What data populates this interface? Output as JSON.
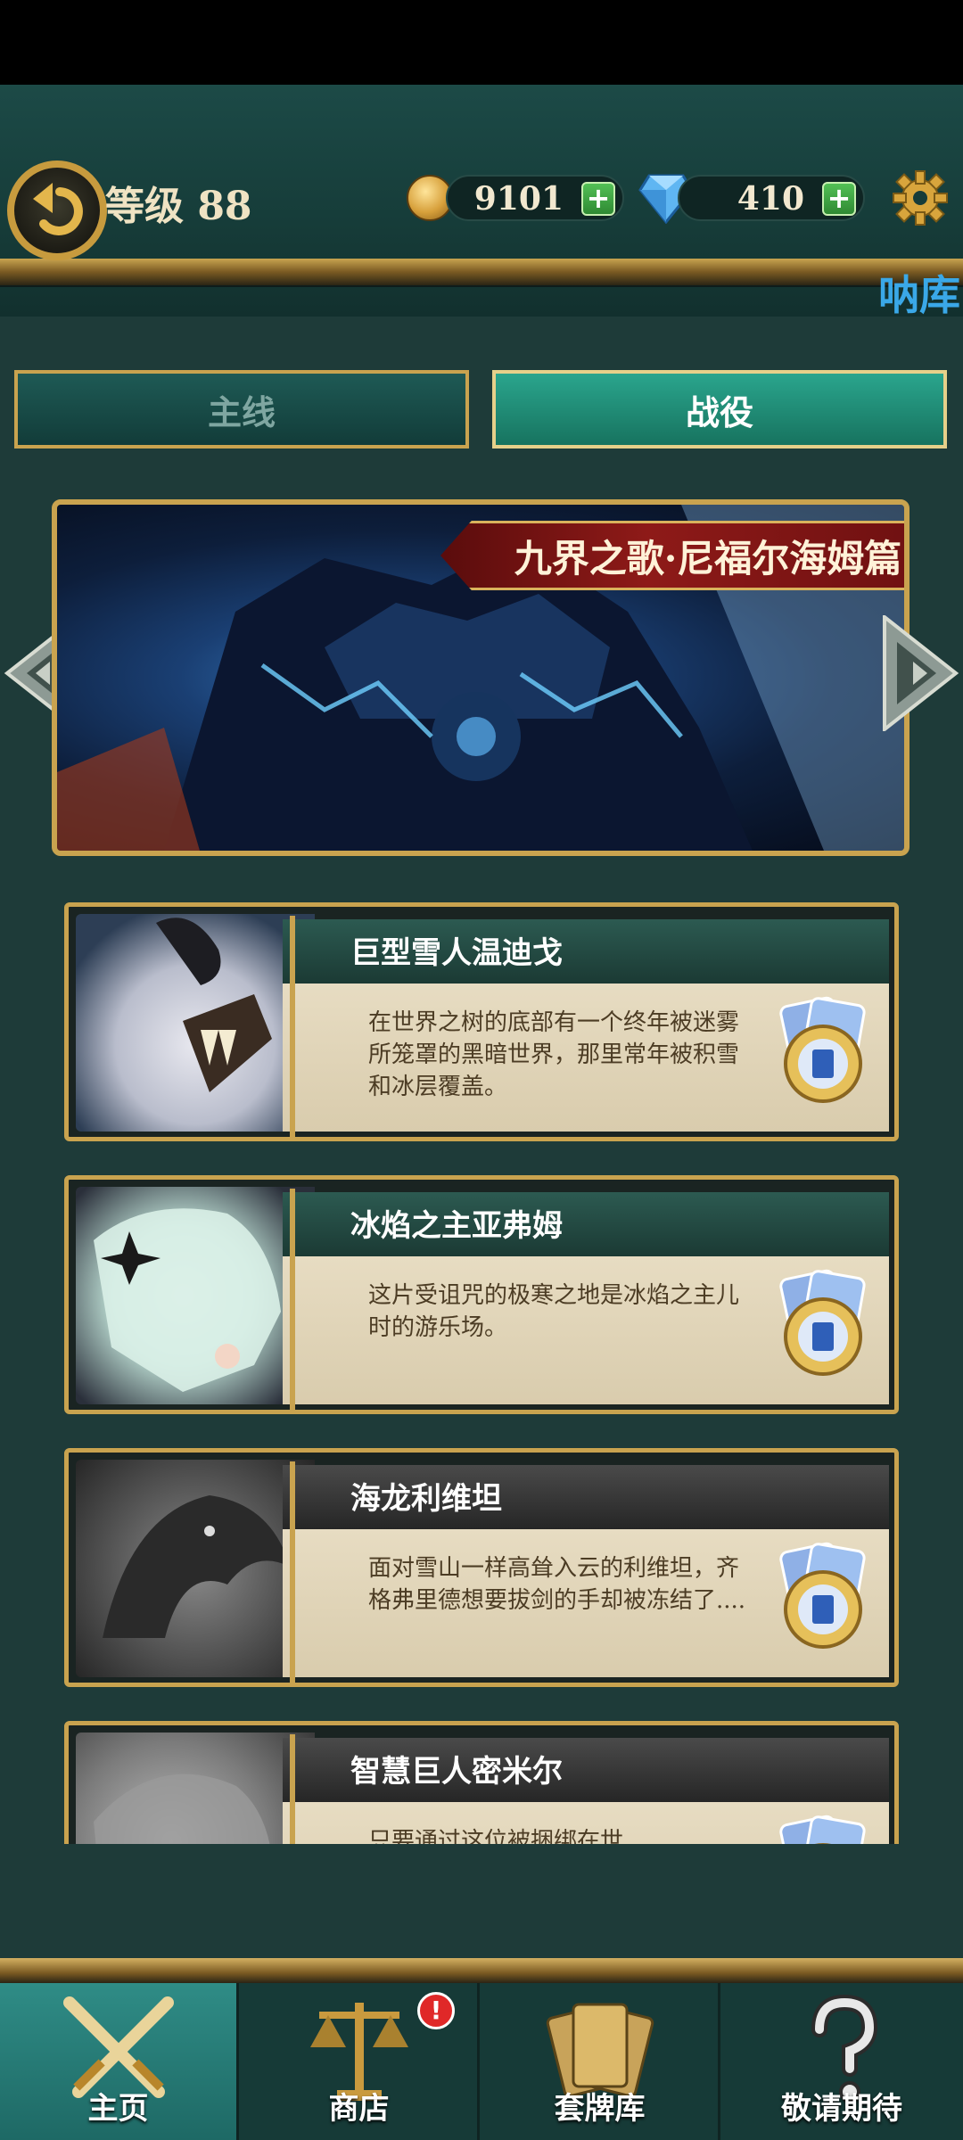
{
  "header": {
    "level_text": "等级 88",
    "gold": "9101",
    "gems": "410",
    "plus": "+",
    "side_label": "呐库"
  },
  "tabs": [
    {
      "label": "主线",
      "active": false
    },
    {
      "label": "战役",
      "active": true
    }
  ],
  "banner": {
    "title": "九界之歌·尼福尔海姆篇"
  },
  "chapters": [
    {
      "name": "巨型雪人温迪戈",
      "desc": "在世界之树的底部有一个终年被迷雾所笼罩的黑暗世界，那里常年被积雪和冰层覆盖。",
      "locked": false
    },
    {
      "name": "冰焰之主亚弗姆",
      "desc": "这片受诅咒的极寒之地是冰焰之主儿时的游乐场。",
      "locked": false
    },
    {
      "name": "海龙利维坦",
      "desc": "面对雪山一样高耸入云的利维坦，齐格弗里德想要拔剑的手却被冻结了....",
      "locked": true
    },
    {
      "name": "智慧巨人密米尔",
      "desc": "只要通过这位被捆绑在世",
      "locked": true
    }
  ],
  "bottom_nav": [
    {
      "label": "主页",
      "active": true
    },
    {
      "label": "商店",
      "active": false
    },
    {
      "label": "套牌库",
      "active": false
    },
    {
      "label": "敬请期待",
      "active": false
    }
  ],
  "shop_badge": "!",
  "icons": {
    "back": "back-arrow-icon",
    "coin": "gold-coin-icon",
    "gem": "diamond-icon",
    "settings": "gear-icon",
    "nav": [
      "crossed-swords-icon",
      "scales-icon",
      "cards-icon",
      "question-mark-icon"
    ]
  }
}
